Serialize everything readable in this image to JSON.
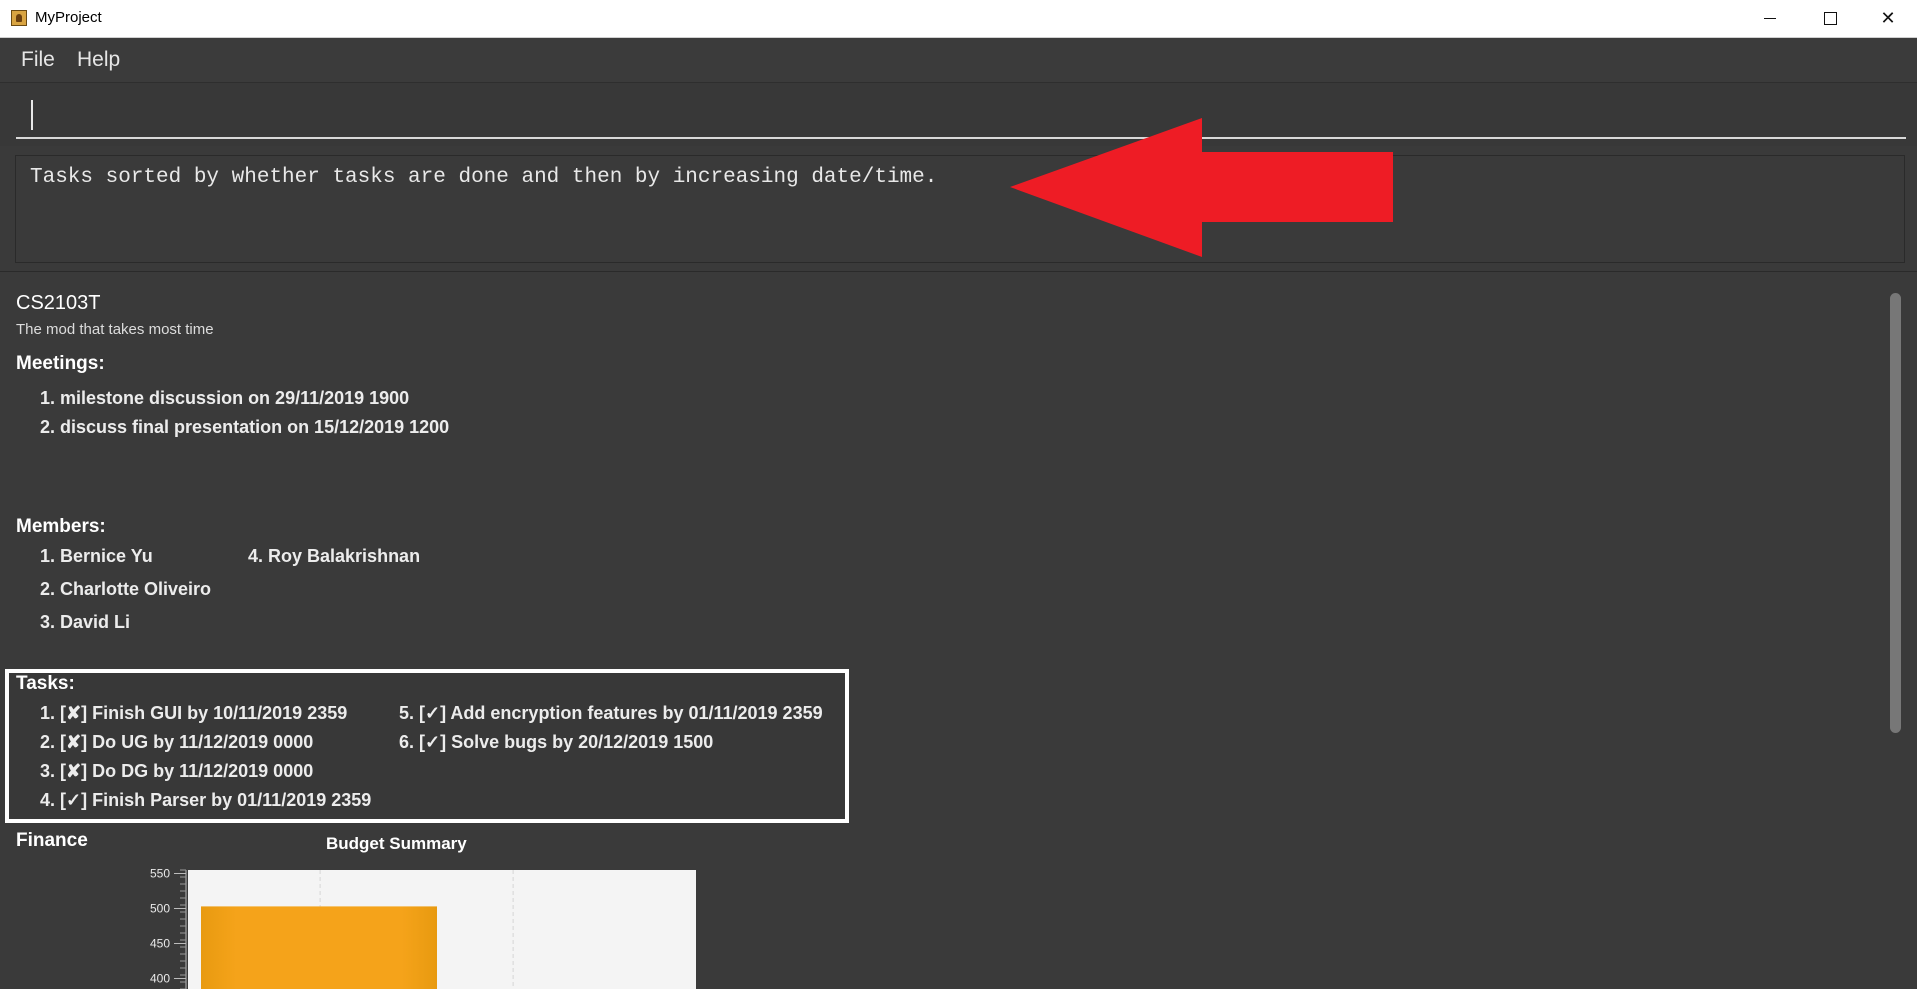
{
  "window": {
    "title": "MyProject",
    "controls": [
      "minimize",
      "maximize",
      "close"
    ]
  },
  "menu": {
    "items": [
      "File",
      "Help"
    ]
  },
  "command": {
    "value": "",
    "placeholder": ""
  },
  "result": {
    "message": "Tasks sorted by whether tasks are done and then by increasing date/time."
  },
  "annotation": {
    "arrow_color": "#ee1c25",
    "tasks_frame_color": "#ffffff"
  },
  "project": {
    "title": "CS2103T",
    "description": "The mod that takes most time",
    "meetings_heading": "Meetings:",
    "meetings": [
      "1. milestone discussion on 29/11/2019 1900",
      "2. discuss final presentation on 15/12/2019 1200"
    ],
    "members_heading": "Members:",
    "members": [
      "1. Bernice Yu",
      "2. Charlotte Oliveiro",
      "3. David Li",
      "4. Roy Balakrishnan"
    ],
    "tasks_heading": "Tasks:",
    "tasks": [
      "1. [✘] Finish GUI by 10/11/2019 2359",
      "2. [✘] Do UG by 11/12/2019 0000",
      "3. [✘] Do DG by 11/12/2019 0000",
      "4. [✓] Finish Parser by 01/11/2019 2359",
      "5. [✓] Add encryption features by 01/11/2019 2359",
      "6. [✓] Solve bugs by 20/12/2019 1500"
    ],
    "finance_heading": "Finance"
  },
  "chart_data": {
    "type": "bar",
    "title": "Budget Summary",
    "categories": [
      ""
    ],
    "values": [
      503
    ],
    "yticks": [
      400,
      450,
      500,
      550
    ],
    "ylim": [
      385,
      555
    ],
    "bar_color": "#f5a31a",
    "grid": true
  }
}
